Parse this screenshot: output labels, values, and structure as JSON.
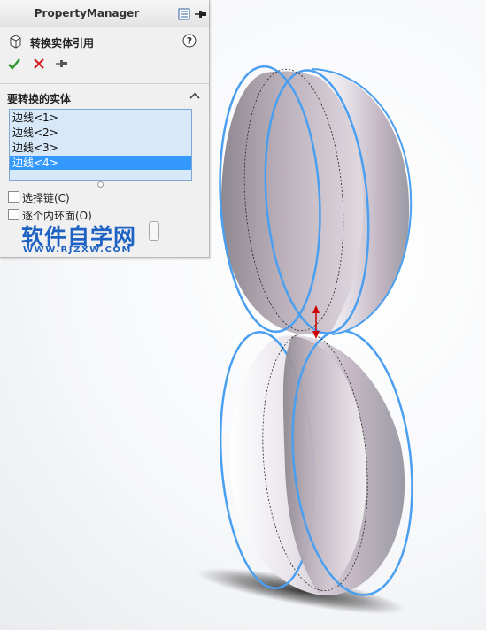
{
  "property_manager": {
    "header_title": "PropertyManager",
    "header_icons": [
      "property-manager-icon",
      "pin-icon"
    ],
    "feature_title": "转换实体引用",
    "feature_icon": "convert-entities-icon",
    "help_icon": "help-icon",
    "actions": {
      "ok_icon": "checkmark-icon",
      "cancel_icon": "cross-icon",
      "pin_icon": "pushpin-icon"
    },
    "group": {
      "title": "要转换的实体",
      "chevron_icon": "chevron-up-icon",
      "items": [
        {
          "label": "边线<1>",
          "selected": false
        },
        {
          "label": "边线<2>",
          "selected": false
        },
        {
          "label": "边线<3>",
          "selected": false
        },
        {
          "label": "边线<4>",
          "selected": true
        }
      ]
    },
    "options": [
      {
        "label": "选择链(C)",
        "checked": false
      },
      {
        "label": "逐个内环面(O)",
        "checked": false
      }
    ]
  },
  "watermark": {
    "title": "软件自学网",
    "url": "WWW.RJZXW.COM"
  },
  "colors": {
    "accent": "#3399ff",
    "edge_highlight": "#4a9ff0",
    "ok_green": "#2e9a2e",
    "cancel_red": "#d32020",
    "watermark_blue": "#1e63c4",
    "dimension_arrow": "#cc0000"
  }
}
